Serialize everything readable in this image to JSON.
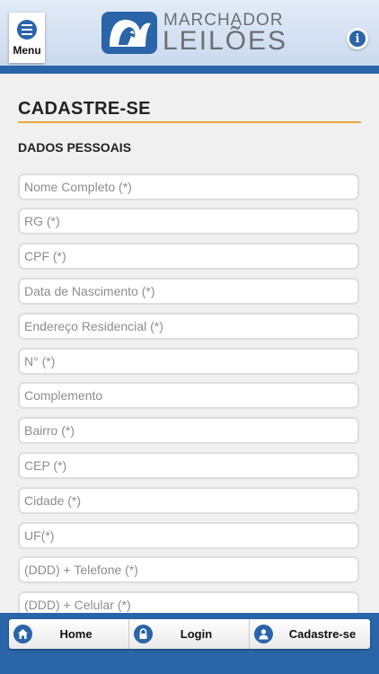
{
  "header": {
    "menu_label": "Menu",
    "logo_line1": "MARCHADOR",
    "logo_line2": "LEILÕES",
    "info_glyph": "i"
  },
  "page": {
    "title": "CADASTRE-SE",
    "section": "DADOS PESSOAIS"
  },
  "form": {
    "fields": [
      {
        "placeholder": "Nome Completo (*)",
        "value": ""
      },
      {
        "placeholder": "RG (*)",
        "value": ""
      },
      {
        "placeholder": "CPF (*)",
        "value": ""
      },
      {
        "placeholder": "Data de Nascimento (*)",
        "value": ""
      },
      {
        "placeholder": "Endereço Residencial (*)",
        "value": ""
      },
      {
        "placeholder": "N° (*)",
        "value": ""
      },
      {
        "placeholder": "Complemento",
        "value": ""
      },
      {
        "placeholder": "Bairro (*)",
        "value": ""
      },
      {
        "placeholder": "CEP (*)",
        "value": ""
      },
      {
        "placeholder": "Cidade (*)",
        "value": ""
      },
      {
        "placeholder": "UF(*)",
        "value": ""
      },
      {
        "placeholder": "(DDD) + Telefone (*)",
        "value": ""
      },
      {
        "placeholder": "(DDD) + Celular (*)",
        "value": ""
      }
    ]
  },
  "footer": {
    "tabs": [
      {
        "label": "Home",
        "icon": "home-icon"
      },
      {
        "label": "Login",
        "icon": "lock-icon"
      },
      {
        "label": "Cadastre-se",
        "icon": "user-icon"
      }
    ]
  },
  "colors": {
    "brand_blue": "#2a64a9",
    "accent_orange": "#f0a43a",
    "background": "#f0f0f0"
  }
}
